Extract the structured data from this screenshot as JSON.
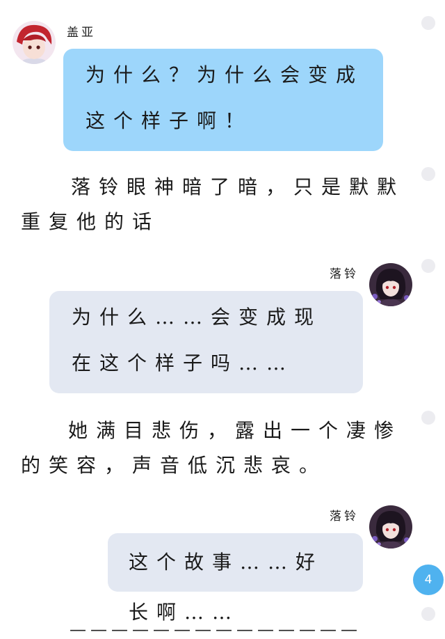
{
  "messages": [
    {
      "speaker": "盖亚",
      "text": "为什么？为什么会变成这个样子啊！",
      "style": "blue"
    },
    {
      "narration": "落铃眼神暗了暗，只是默默重复他的话"
    },
    {
      "speaker": "落铃",
      "text": "为什么……会变成现在这个样子吗……",
      "style": "gray"
    },
    {
      "narration": "她满目悲伤，露出一个凄惨的笑容，声音低沉悲哀。"
    },
    {
      "speaker": "落铃",
      "text": "这个故事……好长啊……",
      "style": "gray"
    }
  ],
  "page_badge": "4",
  "separator": "——————————————",
  "colors": {
    "blue_bubble": "#9dd6fb",
    "gray_bubble": "#e3e8f2",
    "badge": "#4fb2ef"
  }
}
